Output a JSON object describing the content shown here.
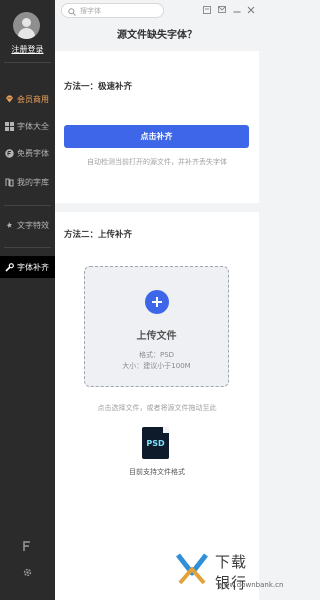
{
  "sidebar": {
    "login_label": "注册登录",
    "items": [
      {
        "label": "会员商用",
        "icon": "vip-diamond-icon"
      },
      {
        "label": "字体大全",
        "icon": "grid-icon"
      },
      {
        "label": "免费字体",
        "icon": "free-badge-icon"
      },
      {
        "label": "我的字库",
        "icon": "my-library-icon"
      },
      {
        "label": "文字特效",
        "icon": "text-effect-icon"
      },
      {
        "label": "字体补齐",
        "icon": "wrench-icon"
      }
    ],
    "bottom_icons": [
      "font-tool-icon",
      "gear-icon"
    ]
  },
  "search": {
    "placeholder": "搜字体"
  },
  "window_controls": [
    "skin-icon",
    "mail-icon",
    "minimize-icon",
    "close-icon"
  ],
  "main": {
    "title": "源文件缺失字体？",
    "method1": {
      "heading": "方法一：极速补齐",
      "button_label": "点击补齐",
      "hint": "自动检测当前打开的源文件，并补齐丢失字体"
    },
    "method2": {
      "heading": "方法二：上传补齐",
      "upload_title": "上传文件",
      "format_text": "格式：PSD",
      "size_text": "大小：建议小于100M",
      "hint": "点击选择文件，或者将源文件拖动至此",
      "psd_icon_text": "PSD",
      "supported_text": "目前支持文件格式"
    }
  },
  "watermark": {
    "name": "下载银行",
    "url": "www.downbank.cn"
  },
  "colors": {
    "accent": "#3d66e8",
    "vip": "#f0a25a",
    "sidebar": "#2b2b2b"
  }
}
